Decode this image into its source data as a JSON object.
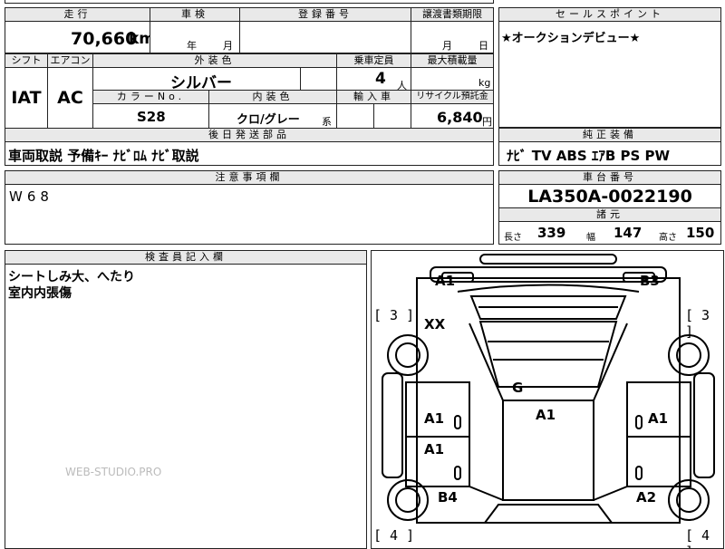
{
  "top": {
    "mileage_label": "走行",
    "mileage_value": "70,660",
    "mileage_unit": "km",
    "inspection_label": "車検",
    "inspection_year": "年",
    "inspection_month": "月",
    "registration_label": "登録番号",
    "transfer_label": "譲渡書類期限",
    "transfer_month": "月",
    "transfer_day": "日"
  },
  "sales_point": {
    "label": "セールスポイント",
    "text": "★オークションデビュー★"
  },
  "specs": {
    "shift_label": "シフト",
    "shift_value": "IAT",
    "ac_label": "エアコン",
    "ac_value": "AC",
    "exterior_label": "外装色",
    "exterior_value": "シルバー",
    "capacity_label": "乗車定員",
    "capacity_value": "4",
    "capacity_unit": "人",
    "load_label": "最大積載量",
    "load_unit": "kg",
    "color_no_label": "カラーNo.",
    "color_no_value": "S28",
    "interior_label": "内装色",
    "interior_value": "クロ/グレー",
    "interior_suffix": "系",
    "import_label": "輸入車",
    "recycle_label": "リサイクル預託金",
    "recycle_value": "6,840",
    "recycle_unit": "円"
  },
  "parts": {
    "label": "後日発送部品",
    "text": "車両取説 予備ｷｰ ﾅﾋﾞﾛﾑ ﾅﾋﾞ取説"
  },
  "equipment": {
    "label": "純正装備",
    "text": "ﾅﾋﾞ TV ABS ｴｱB PS PW"
  },
  "notes": {
    "label": "注意事項欄",
    "text": "W68"
  },
  "chassis": {
    "label": "車台番号",
    "value": "LA350A-0022190",
    "dims_label": "諸元",
    "length_label": "長さ",
    "length_value": "339",
    "width_label": "幅",
    "width_value": "147",
    "height_label": "高さ",
    "height_value": "150"
  },
  "inspector": {
    "label": "検査員記入欄",
    "line1": "シートしみ大、へたり",
    "line2": "室内内張傷"
  },
  "watermark": "WEB-STUDIO.PRO",
  "diagram": {
    "marks": {
      "front_left": "A1",
      "front_right": "B3",
      "xx": "XX",
      "glass": "G",
      "roof": "A1",
      "left_door_front": "A1",
      "left_door_rear": "A1",
      "right_door": "A1",
      "left_rear": "B4",
      "right_rear": "A2"
    },
    "brackets": {
      "left_front": "[ 3 ]",
      "right_front": "[ 3 ]",
      "left_rear": "[ 4 ]",
      "right_rear": "[ 4 ]"
    }
  }
}
